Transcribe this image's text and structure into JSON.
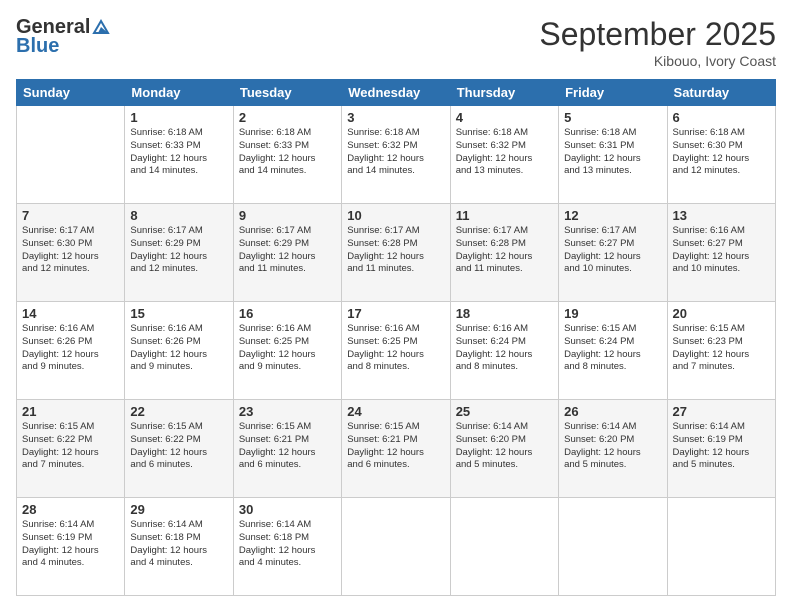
{
  "header": {
    "logo_line1": "General",
    "logo_line2": "Blue",
    "month_title": "September 2025",
    "location": "Kibouo, Ivory Coast"
  },
  "days_of_week": [
    "Sunday",
    "Monday",
    "Tuesday",
    "Wednesday",
    "Thursday",
    "Friday",
    "Saturday"
  ],
  "weeks": [
    [
      {
        "day": "",
        "info": ""
      },
      {
        "day": "1",
        "info": "Sunrise: 6:18 AM\nSunset: 6:33 PM\nDaylight: 12 hours\nand 14 minutes."
      },
      {
        "day": "2",
        "info": "Sunrise: 6:18 AM\nSunset: 6:33 PM\nDaylight: 12 hours\nand 14 minutes."
      },
      {
        "day": "3",
        "info": "Sunrise: 6:18 AM\nSunset: 6:32 PM\nDaylight: 12 hours\nand 14 minutes."
      },
      {
        "day": "4",
        "info": "Sunrise: 6:18 AM\nSunset: 6:32 PM\nDaylight: 12 hours\nand 13 minutes."
      },
      {
        "day": "5",
        "info": "Sunrise: 6:18 AM\nSunset: 6:31 PM\nDaylight: 12 hours\nand 13 minutes."
      },
      {
        "day": "6",
        "info": "Sunrise: 6:18 AM\nSunset: 6:30 PM\nDaylight: 12 hours\nand 12 minutes."
      }
    ],
    [
      {
        "day": "7",
        "info": "Sunrise: 6:17 AM\nSunset: 6:30 PM\nDaylight: 12 hours\nand 12 minutes."
      },
      {
        "day": "8",
        "info": "Sunrise: 6:17 AM\nSunset: 6:29 PM\nDaylight: 12 hours\nand 12 minutes."
      },
      {
        "day": "9",
        "info": "Sunrise: 6:17 AM\nSunset: 6:29 PM\nDaylight: 12 hours\nand 11 minutes."
      },
      {
        "day": "10",
        "info": "Sunrise: 6:17 AM\nSunset: 6:28 PM\nDaylight: 12 hours\nand 11 minutes."
      },
      {
        "day": "11",
        "info": "Sunrise: 6:17 AM\nSunset: 6:28 PM\nDaylight: 12 hours\nand 11 minutes."
      },
      {
        "day": "12",
        "info": "Sunrise: 6:17 AM\nSunset: 6:27 PM\nDaylight: 12 hours\nand 10 minutes."
      },
      {
        "day": "13",
        "info": "Sunrise: 6:16 AM\nSunset: 6:27 PM\nDaylight: 12 hours\nand 10 minutes."
      }
    ],
    [
      {
        "day": "14",
        "info": "Sunrise: 6:16 AM\nSunset: 6:26 PM\nDaylight: 12 hours\nand 9 minutes."
      },
      {
        "day": "15",
        "info": "Sunrise: 6:16 AM\nSunset: 6:26 PM\nDaylight: 12 hours\nand 9 minutes."
      },
      {
        "day": "16",
        "info": "Sunrise: 6:16 AM\nSunset: 6:25 PM\nDaylight: 12 hours\nand 9 minutes."
      },
      {
        "day": "17",
        "info": "Sunrise: 6:16 AM\nSunset: 6:25 PM\nDaylight: 12 hours\nand 8 minutes."
      },
      {
        "day": "18",
        "info": "Sunrise: 6:16 AM\nSunset: 6:24 PM\nDaylight: 12 hours\nand 8 minutes."
      },
      {
        "day": "19",
        "info": "Sunrise: 6:15 AM\nSunset: 6:24 PM\nDaylight: 12 hours\nand 8 minutes."
      },
      {
        "day": "20",
        "info": "Sunrise: 6:15 AM\nSunset: 6:23 PM\nDaylight: 12 hours\nand 7 minutes."
      }
    ],
    [
      {
        "day": "21",
        "info": "Sunrise: 6:15 AM\nSunset: 6:22 PM\nDaylight: 12 hours\nand 7 minutes."
      },
      {
        "day": "22",
        "info": "Sunrise: 6:15 AM\nSunset: 6:22 PM\nDaylight: 12 hours\nand 6 minutes."
      },
      {
        "day": "23",
        "info": "Sunrise: 6:15 AM\nSunset: 6:21 PM\nDaylight: 12 hours\nand 6 minutes."
      },
      {
        "day": "24",
        "info": "Sunrise: 6:15 AM\nSunset: 6:21 PM\nDaylight: 12 hours\nand 6 minutes."
      },
      {
        "day": "25",
        "info": "Sunrise: 6:14 AM\nSunset: 6:20 PM\nDaylight: 12 hours\nand 5 minutes."
      },
      {
        "day": "26",
        "info": "Sunrise: 6:14 AM\nSunset: 6:20 PM\nDaylight: 12 hours\nand 5 minutes."
      },
      {
        "day": "27",
        "info": "Sunrise: 6:14 AM\nSunset: 6:19 PM\nDaylight: 12 hours\nand 5 minutes."
      }
    ],
    [
      {
        "day": "28",
        "info": "Sunrise: 6:14 AM\nSunset: 6:19 PM\nDaylight: 12 hours\nand 4 minutes."
      },
      {
        "day": "29",
        "info": "Sunrise: 6:14 AM\nSunset: 6:18 PM\nDaylight: 12 hours\nand 4 minutes."
      },
      {
        "day": "30",
        "info": "Sunrise: 6:14 AM\nSunset: 6:18 PM\nDaylight: 12 hours\nand 4 minutes."
      },
      {
        "day": "",
        "info": ""
      },
      {
        "day": "",
        "info": ""
      },
      {
        "day": "",
        "info": ""
      },
      {
        "day": "",
        "info": ""
      }
    ]
  ]
}
